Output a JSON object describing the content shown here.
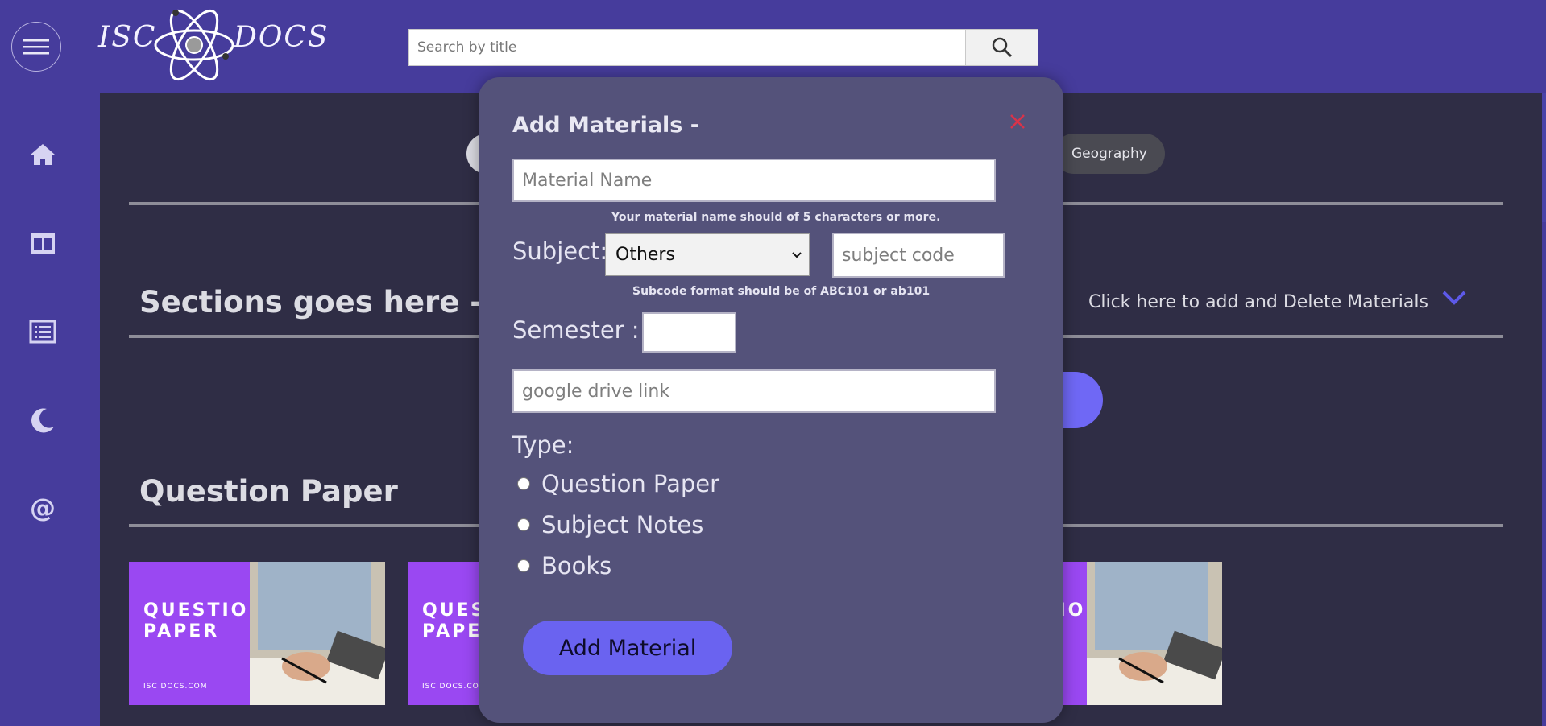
{
  "header": {
    "logo_left": "ISC",
    "logo_right": "DOCS",
    "search_placeholder": "Search by title"
  },
  "sidebar": {
    "items": [
      {
        "icon": "home-icon"
      },
      {
        "icon": "columns-icon"
      },
      {
        "icon": "list-icon"
      },
      {
        "icon": "moon-icon"
      },
      {
        "icon": "at-icon"
      }
    ]
  },
  "main": {
    "subject_pills": [
      "Geography"
    ],
    "sections_title": "Sections goes here -",
    "manage_label": "Click here to add and Delete Materials",
    "question_paper_title": "Question Paper",
    "card": {
      "line1": "QUESTION",
      "line2": "PAPER",
      "footer": "ISC DOCS.COM"
    }
  },
  "modal": {
    "title": "Add Materials -",
    "material_placeholder": "Material Name",
    "material_hint": "Your material name should of 5 characters or more.",
    "subject_label": "Subject:",
    "subject_selected": "Others",
    "subject_code_placeholder": "subject code",
    "subcode_hint": "Subcode format should be of ABC101 or ab101",
    "semester_label": "Semester :",
    "drive_placeholder": "google drive link",
    "type_label": "Type:",
    "type_options": [
      "Question Paper",
      "Subject Notes",
      "Books"
    ],
    "submit_label": "Add Material"
  },
  "colors": {
    "brand": "#463c9c",
    "panel": "#2f2d45",
    "modal": "#54527a",
    "accent": "#6a63f0",
    "close": "#d9334a"
  }
}
